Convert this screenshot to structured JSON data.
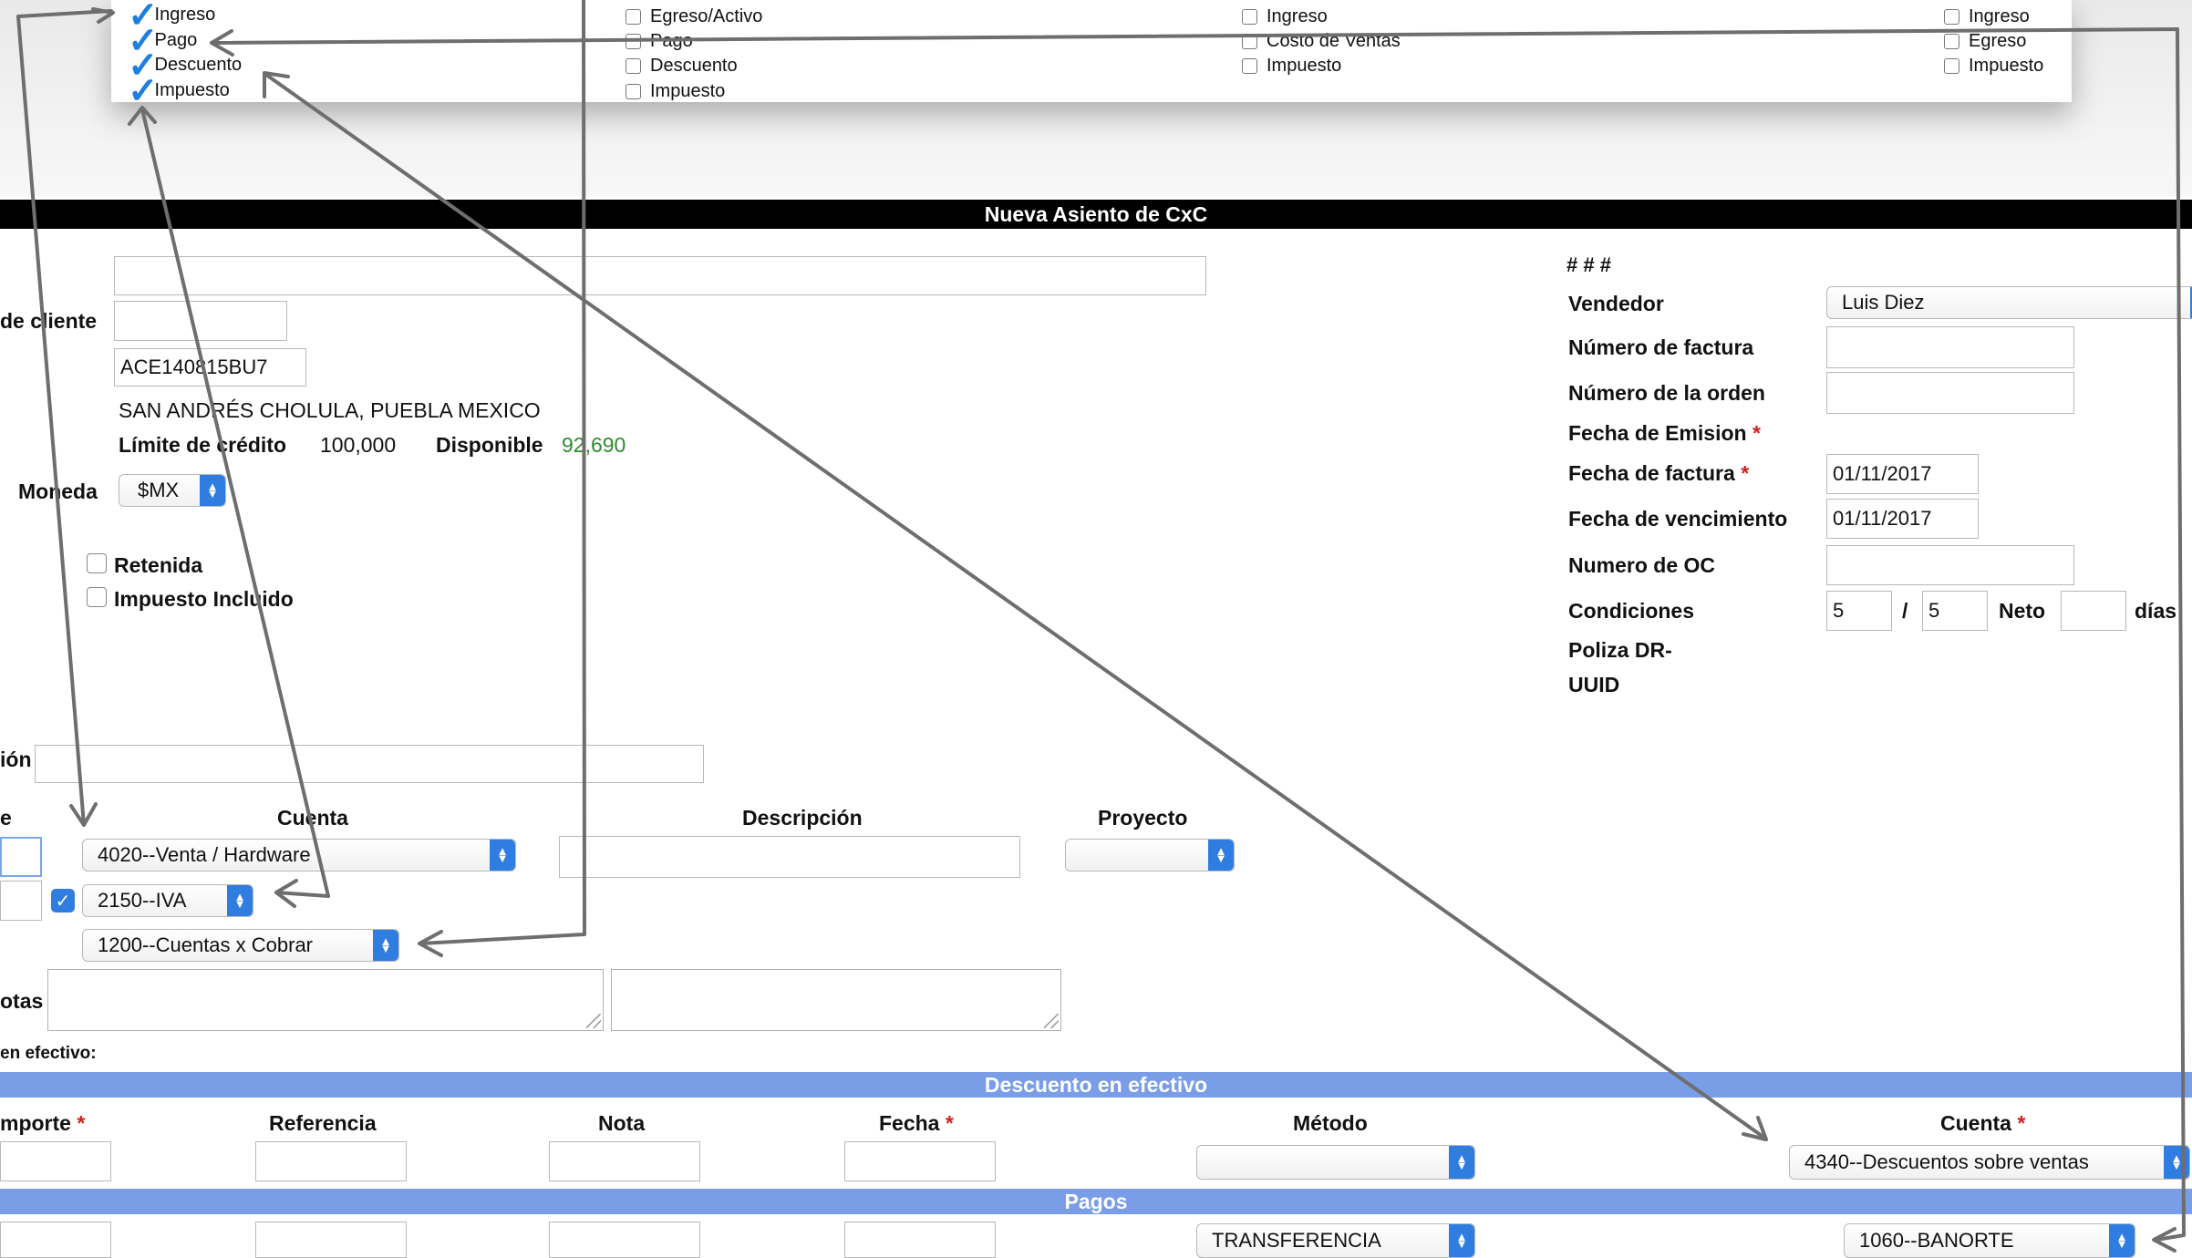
{
  "top_panel": {
    "col1": [
      "Ingreso",
      "Pago",
      "Descuento",
      "Impuesto"
    ],
    "col2": [
      "Egreso/Activo",
      "Pago",
      "Descuento",
      "Impuesto"
    ],
    "col3": [
      "Ingreso",
      "Costo de Ventas",
      "Impuesto"
    ],
    "col4": [
      "Ingreso",
      "Egreso",
      "Impuesto"
    ]
  },
  "title": "Nueva Asiento de CxC",
  "left": {
    "cliente_label": "de cliente",
    "rfc": "ACE140815BU7",
    "address": "SAN ANDRÉS CHOLULA, PUEBLA MEXICO",
    "limite_label": "Límite de crédito",
    "limite_value": "100,000",
    "disponible_label": "Disponible",
    "disponible_value": "92,690",
    "moneda_label": "Moneda",
    "moneda_value": "$MX",
    "retenida_label": "Retenida",
    "impuesto_incluido_label": "Impuesto Incluido",
    "descripcion_label": "ión"
  },
  "right": {
    "hash": "# # #",
    "vendedor_label": "Vendedor",
    "vendedor_value": "Luis Diez",
    "num_factura_label": "Número de factura",
    "num_orden_label": "Número de la orden",
    "fecha_emision_label": "Fecha de Emision",
    "fecha_factura_label": "Fecha de factura",
    "fecha_factura_value": "01/11/2017",
    "fecha_venc_label": "Fecha de vencimiento",
    "fecha_venc_value": "01/11/2017",
    "numero_oc_label": "Numero de OC",
    "condiciones_label": "Condiciones",
    "cond_1": "5",
    "cond_sep": "/",
    "cond_2": "5",
    "neto_label": "Neto",
    "dias_label": "días",
    "poliza_label": "Poliza DR-",
    "uuid_label": "UUID"
  },
  "lines": {
    "headers": {
      "importe": "e",
      "cuenta": "Cuenta",
      "descripcion": "Descripción",
      "proyecto": "Proyecto"
    },
    "cuenta_1": "4020--Venta / Hardware",
    "cuenta_2": "2150--IVA",
    "cuenta_3": "1200--Cuentas x Cobrar",
    "notas_label": "otas",
    "efectivo_label": "en efectivo:"
  },
  "descuento": {
    "bar": "Descuento en efectivo",
    "importe": "mporte",
    "referencia": "Referencia",
    "nota": "Nota",
    "fecha": "Fecha",
    "metodo": "Método",
    "cuenta": "Cuenta",
    "cuenta_value": "4340--Descuentos sobre ventas"
  },
  "pagos": {
    "bar": "Pagos",
    "metodo_value": "TRANSFERENCIA",
    "cuenta_value": "1060--BANORTE"
  },
  "colors": {
    "accent": "#2f7de1",
    "bar_blue": "#7a9de8",
    "green": "#2e8b2e",
    "arrow": "#6e6e6e"
  }
}
